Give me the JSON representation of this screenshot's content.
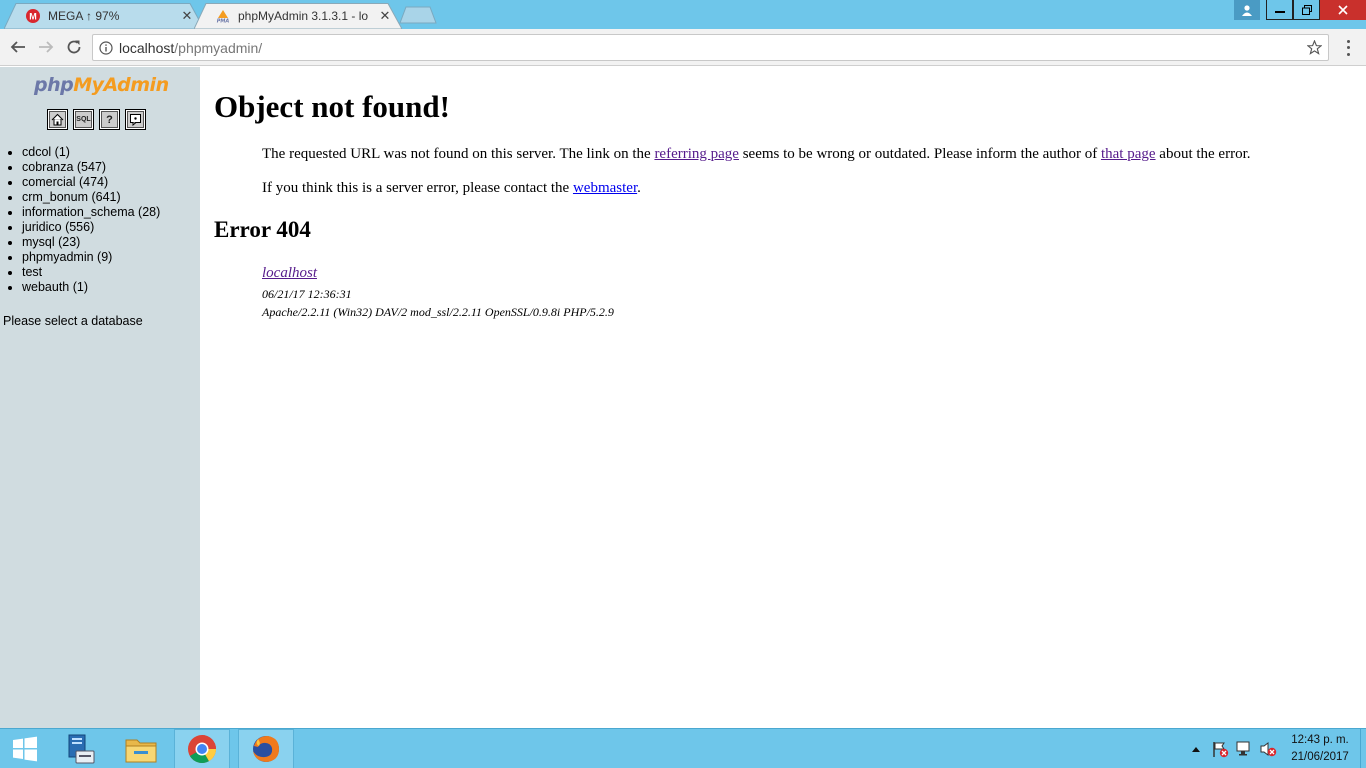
{
  "browser": {
    "tabs": [
      {
        "favicon": "mega-icon",
        "title": "MEGA ↑ 97%"
      },
      {
        "favicon": "pma-icon",
        "title": "phpMyAdmin 3.1.3.1 - lo"
      }
    ],
    "address": {
      "host": "localhost",
      "path": "/phpmyadmin/"
    }
  },
  "pma": {
    "logo": {
      "php": "php",
      "my": "My",
      "admin": "Admin"
    },
    "toolbar_icons": [
      "home-icon",
      "sql-icon",
      "docs-icon",
      "query-window-icon"
    ],
    "sql_label": "SQL",
    "databases": [
      "cdcol (1)",
      "cobranza (547)",
      "comercial (474)",
      "crm_bonum (641)",
      "information_schema (28)",
      "juridico (556)",
      "mysql (23)",
      "phpmyadmin (9)",
      "test",
      "webauth (1)"
    ],
    "select_message": "Please select a database"
  },
  "error_page": {
    "title": "Object not found!",
    "p1_a": "The requested URL was not found on this server. The link on the ",
    "p1_link1": "referring page",
    "p1_b": " seems to be wrong or outdated. Please inform the author of ",
    "p1_link2": "that page",
    "p1_c": " about the error.",
    "p2_a": "If you think this is a server error, please contact the ",
    "p2_link": "webmaster",
    "p2_b": ".",
    "error_heading": "Error 404",
    "host": "localhost",
    "date": "06/21/17 12:36:31",
    "server": "Apache/2.2.11 (Win32) DAV/2 mod_ssl/2.2.11 OpenSSL/0.9.8i PHP/5.2.9"
  },
  "taskbar": {
    "apps": [
      "windows-start-icon",
      "server-manager-icon",
      "file-explorer-icon",
      "chrome-icon",
      "firefox-icon"
    ],
    "clock": {
      "time": "12:43 p. m.",
      "date": "21/06/2017"
    }
  },
  "colors": {
    "titlebar": "#6ec6ea",
    "pma_nav_bg": "#d0dce0",
    "link_visited": "#551a8b",
    "link": "#0000ee"
  }
}
